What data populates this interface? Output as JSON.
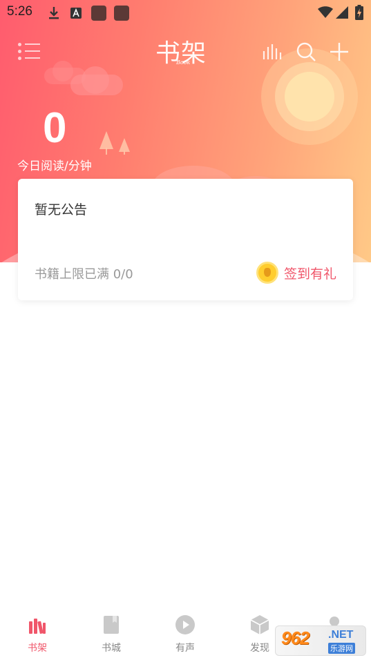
{
  "status_bar": {
    "time": "5:26"
  },
  "header": {
    "brand_main": "书架",
    "brand_sub": "Book"
  },
  "stats": {
    "today_minutes": "0",
    "today_label": "今日阅读/分钟"
  },
  "card": {
    "notice": "暂无公告",
    "limit": "书籍上限已满 0/0",
    "signin": "签到有礼"
  },
  "bottom_nav": {
    "items": [
      {
        "label": "书架",
        "active": true
      },
      {
        "label": "书城",
        "active": false
      },
      {
        "label": "有声",
        "active": false
      },
      {
        "label": "发现",
        "active": false
      }
    ]
  },
  "watermark": {
    "number": "962",
    "net": ".NET",
    "site": "乐游网"
  },
  "colors": {
    "accent": "#f0566a",
    "hero_start": "#ff5c6e",
    "hero_end": "#ffc987",
    "coin": "#ffcd2e"
  }
}
